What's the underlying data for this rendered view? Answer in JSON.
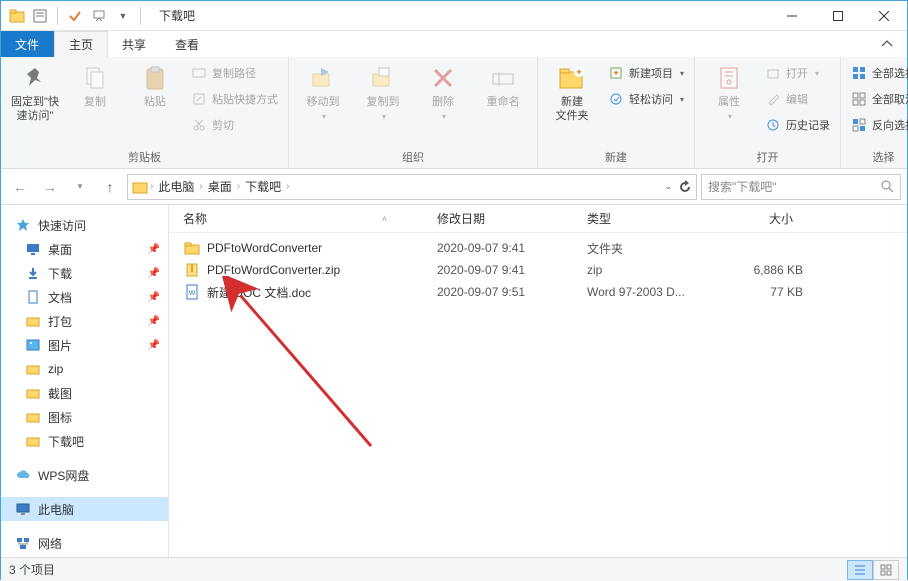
{
  "window": {
    "title": "下载吧"
  },
  "tabs": {
    "file": "文件",
    "home": "主页",
    "share": "共享",
    "view": "查看"
  },
  "ribbon": {
    "pin": "固定到\"快速访问\"",
    "copy": "复制",
    "paste": "粘贴",
    "copy_path": "复制路径",
    "paste_shortcut": "粘贴快捷方式",
    "cut": "剪切",
    "group_clipboard": "剪贴板",
    "move_to": "移动到",
    "copy_to": "复制到",
    "delete": "删除",
    "rename": "重命名",
    "group_organize": "组织",
    "new_folder": "新建\n文件夹",
    "new_item": "新建项目",
    "easy_access": "轻松访问",
    "group_new": "新建",
    "properties": "属性",
    "open": "打开",
    "edit": "编辑",
    "history": "历史记录",
    "group_open": "打开",
    "select_all": "全部选择",
    "select_none": "全部取消",
    "invert_selection": "反向选择",
    "group_select": "选择"
  },
  "breadcrumb": {
    "segments": [
      "此电脑",
      "桌面",
      "下载吧"
    ]
  },
  "search": {
    "placeholder": "搜索\"下载吧\""
  },
  "sidebar": {
    "quick_access": "快速访问",
    "items": [
      "桌面",
      "下载",
      "文档",
      "打包",
      "图片",
      "zip",
      "截图",
      "图标",
      "下载吧"
    ],
    "wps": "WPS网盘",
    "this_pc": "此电脑",
    "network": "网络"
  },
  "columns": {
    "name": "名称",
    "date": "修改日期",
    "type": "类型",
    "size": "大小"
  },
  "files": [
    {
      "icon": "folder",
      "name": "PDFtoWordConverter",
      "date": "2020-09-07 9:41",
      "type": "文件夹",
      "size": ""
    },
    {
      "icon": "zip",
      "name": "PDFtoWordConverter.zip",
      "date": "2020-09-07 9:41",
      "type": "zip",
      "size": "6,886 KB"
    },
    {
      "icon": "doc",
      "name": "新建 DOC 文档.doc",
      "date": "2020-09-07 9:51",
      "type": "Word 97-2003 D...",
      "size": "77 KB"
    }
  ],
  "status": {
    "count": "3 个项目"
  }
}
